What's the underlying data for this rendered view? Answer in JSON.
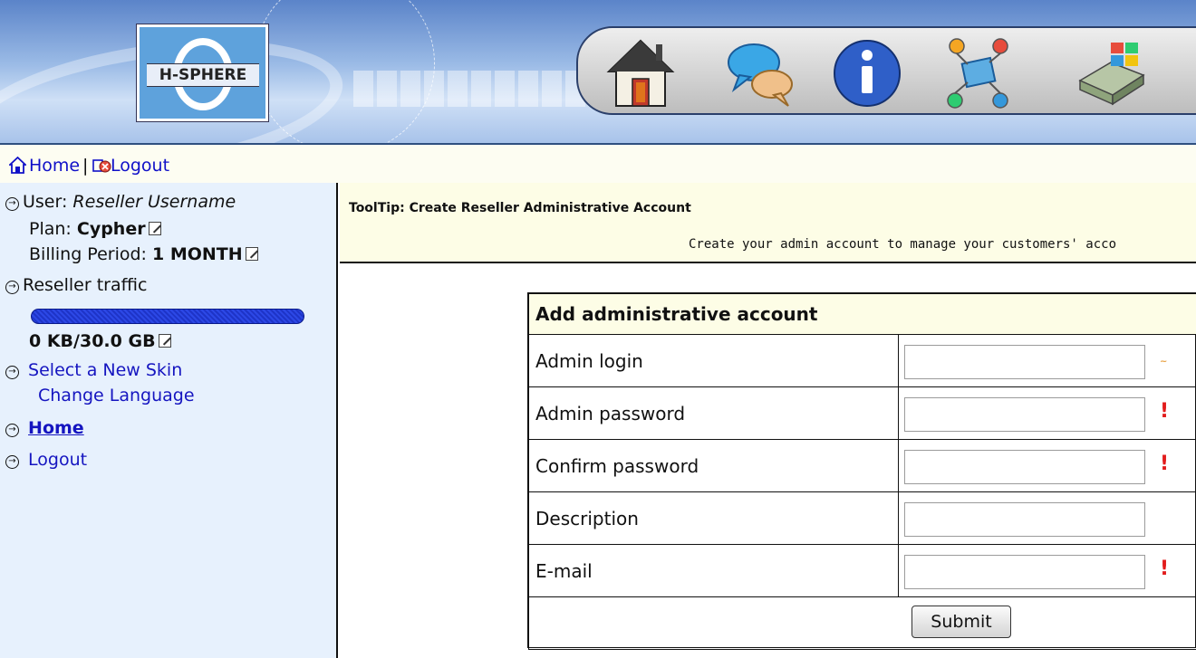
{
  "banner": {
    "logo_text": "H-SPHERE",
    "icons": [
      "home-icon",
      "chat-bubbles-icon",
      "info-icon",
      "network-icon",
      "windows-server-icon"
    ]
  },
  "nav": {
    "home_label": "Home",
    "separator": "|",
    "logout_label": "Logout"
  },
  "sidebar": {
    "user_label": "User:",
    "user_value": "Reseller Username",
    "plan_label": "Plan:",
    "plan_value": "Cypher",
    "billing_label": "Billing Period:",
    "billing_value": "1 MONTH",
    "traffic_label": "Reseller traffic",
    "traffic_value": "0 KB/30.0 GB",
    "traffic_fill": 1.0,
    "skin_label": "Select a New Skin",
    "language_label": "Change Language",
    "home_label": "Home",
    "logout_label": "Logout"
  },
  "tooltip": {
    "title": "ToolTip: Create Reseller Administrative Account",
    "text": "Create your admin account to manage your customers' acco"
  },
  "form": {
    "header": "Add administrative account",
    "rows": [
      {
        "label": "Admin login",
        "value": "",
        "required": "~"
      },
      {
        "label": "Admin password",
        "value": "",
        "required": "!"
      },
      {
        "label": "Confirm password",
        "value": "",
        "required": "!"
      },
      {
        "label": "Description",
        "value": "",
        "required": ""
      },
      {
        "label": "E-mail",
        "value": "",
        "required": "!"
      }
    ],
    "submit_label": "Submit"
  }
}
